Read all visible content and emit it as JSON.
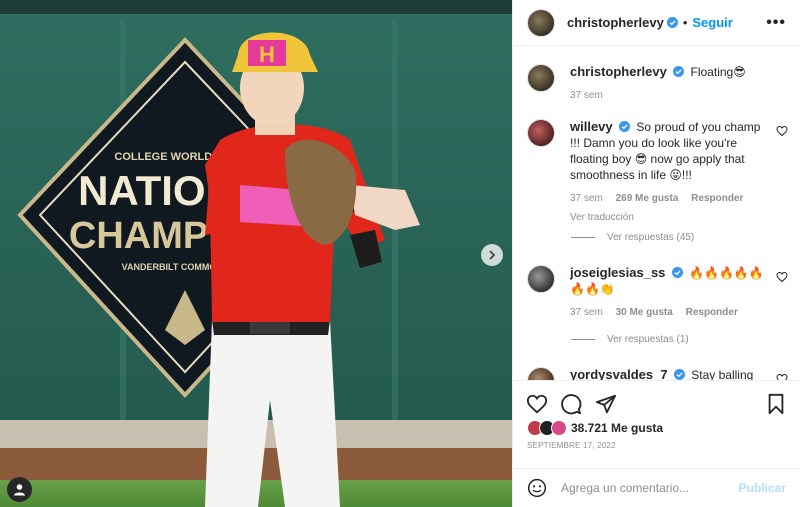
{
  "post": {
    "author": "christopherlevy",
    "follow_label": "Seguir",
    "dot": "•",
    "more_label": "•••"
  },
  "photo": {
    "banner_line1": "COLLEGE WORLD SERIES",
    "banner_line2": "NATIONAL",
    "banner_line3": "CHAMPIONS",
    "banner_line4": "VANDERBILT COMMODORES",
    "cap_letter": "H"
  },
  "caption": {
    "username": "christopherlevy",
    "text": "Floating😎",
    "time": "37 sem"
  },
  "comments": [
    {
      "username": "willevy",
      "text": "So proud of you champ !!! Damn you do look like you're floating boy 😎 now go apply that smoothness in life 😛!!!",
      "time": "37 sem",
      "likes": "269 Me gusta",
      "reply": "Responder",
      "translate": "Ver traducción",
      "view_replies": "Ver respuestas (45)"
    },
    {
      "username": "joseiglesias_ss",
      "text": "🔥🔥🔥🔥🔥🔥🔥👏",
      "time": "37 sem",
      "likes": "30 Me gusta",
      "reply": "Responder",
      "view_replies": "Ver respuestas (1)"
    },
    {
      "username": "yordysvaldes_7",
      "text": "Stay balling"
    }
  ],
  "stats": {
    "likes": "38.721 Me gusta",
    "date": "SEPTIEMBRE 17, 2022"
  },
  "composer": {
    "placeholder": "Agrega un comentario...",
    "publish": "Publicar"
  },
  "colors": {
    "accent": "#0095f6",
    "verified": "#3897f0",
    "publish_disabled": "#b2dffc"
  },
  "icons": {
    "like": "heart-icon",
    "comment": "comment-icon",
    "share": "paper-plane-icon",
    "save": "bookmark-icon",
    "emoji": "smiley-icon",
    "next": "chevron-right-icon",
    "tags": "user-icon"
  }
}
